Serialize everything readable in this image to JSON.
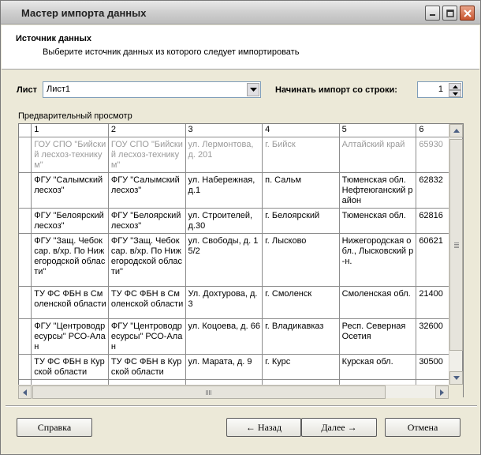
{
  "window": {
    "title": "Мастер импорта данных"
  },
  "header": {
    "title": "Источник данных",
    "subtitle": "Выберите источник данных из которого следует импортировать"
  },
  "sheet": {
    "label": "Лист",
    "value": "Лист1"
  },
  "start_row": {
    "label": "Начинать импорт со строки:",
    "value": "1"
  },
  "preview": {
    "label": "Предварительный просмотр",
    "columns": [
      "1",
      "2",
      "3",
      "4",
      "5",
      "6"
    ],
    "rows": [
      [
        "ГОУ СПО \"Бийский лесхоз-техникум\"",
        "ГОУ СПО \"Бийский лесхоз-техникум\"",
        "ул. Лермонтова, д. 201",
        "г. Бийск",
        "Алтайский край",
        "65930"
      ],
      [
        "ФГУ \"Салымский лесхоз\"",
        "ФГУ \"Салымский лесхоз\"",
        "ул. Набережная, д.1",
        "п. Сальм",
        "Тюменская обл. Нефтеюганский район",
        "62832"
      ],
      [
        "ФГУ \"Белоярский лесхоз\"",
        "ФГУ \"Белоярский лесхоз\"",
        "ул. Строителей, д.30",
        "г. Белоярский",
        "Тюменская обл.",
        "62816"
      ],
      [
        "ФГУ \"Защ. Чебоксар. в/хр. По Нижегородской области\"",
        "ФГУ \"Защ. Чебоксар. в/хр. По Нижегородской области\"",
        "ул. Свободы, д. 15/2",
        "г. Лысково",
        "Нижегородская обл., Лысковский р-н.",
        "60621"
      ],
      [
        "ТУ ФС ФБН в Смоленской области",
        "ТУ ФС ФБН в Смоленской области",
        "Ул. Дохтурова, д.3",
        "г. Смоленск",
        "Смоленская обл.",
        "21400"
      ],
      [
        "ФГУ \"Центроводресурсы\" РСО-Алан",
        "ФГУ \"Центроводресурсы\" РСО-Алан",
        "ул. Коцоева, д. 66",
        "г. Владикавказ",
        "Респ. Северная Осетия",
        "32600"
      ],
      [
        "ТУ ФС ФБН в Курской области",
        "ТУ ФС ФБН в Курской области",
        "ул. Марата, д. 9",
        "г. Курс",
        "Курская обл.",
        "30500"
      ],
      [
        "",
        "",
        "",
        "",
        "",
        ""
      ],
      [
        "",
        "",
        "",
        "",
        "",
        ""
      ]
    ]
  },
  "buttons": {
    "help": "Справка",
    "back": "← Назад",
    "next": "Далее →",
    "cancel": "Отмена"
  }
}
